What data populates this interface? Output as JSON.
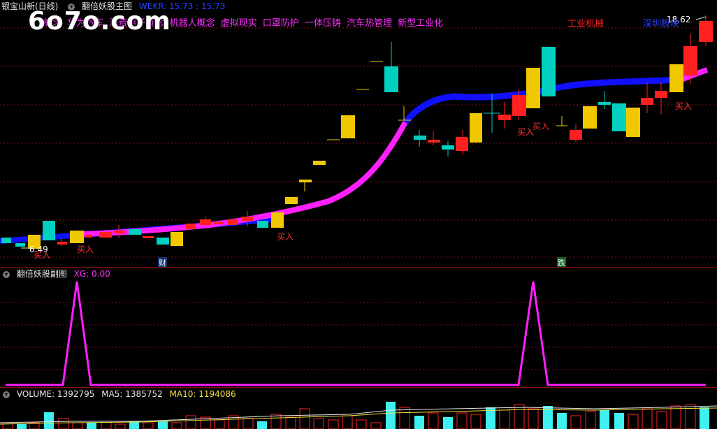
{
  "header": {
    "stock_name": "银宝山新(日线)",
    "main_indicator": "翻倍妖股主图",
    "wekr_label": "WEKR: 15.73 : 15.73"
  },
  "logo_text": "6o7o.com",
  "concepts": {
    "items": [
      "概念",
      "华为汽车",
      "消费电子概念",
      "机器人概念",
      "虚拟现实",
      "口罩防护",
      "一体压铸",
      "汽车热管理",
      "新型工业化"
    ],
    "industry": "工业机械",
    "region": "深圳板块"
  },
  "price_labels": {
    "high": "18.62",
    "low": "6.49"
  },
  "signals": {
    "buy": "买入",
    "finance_marker": "财",
    "fall_marker": "跌"
  },
  "sub_panel": {
    "title": "翻倍妖股副图",
    "xg_label": "XG: 0.00"
  },
  "volume_panel": {
    "volume_label": "VOLUME: 1392795",
    "ma5_label": "MA5: 1385752",
    "ma10_label": "MA10: 1194086"
  },
  "colors": {
    "up": "#ff2020",
    "down": "#00e5e5",
    "gold": "#f0c800",
    "magenta": "#ff20ff",
    "blue": "#1010ff",
    "grid": "#7a1010"
  },
  "chart_data": {
    "type": "candlestick",
    "price_high_label": 18.62,
    "price_low_label": 6.49,
    "xg_peaks": [
      1,
      1
    ],
    "signals_buy_count": 6
  }
}
